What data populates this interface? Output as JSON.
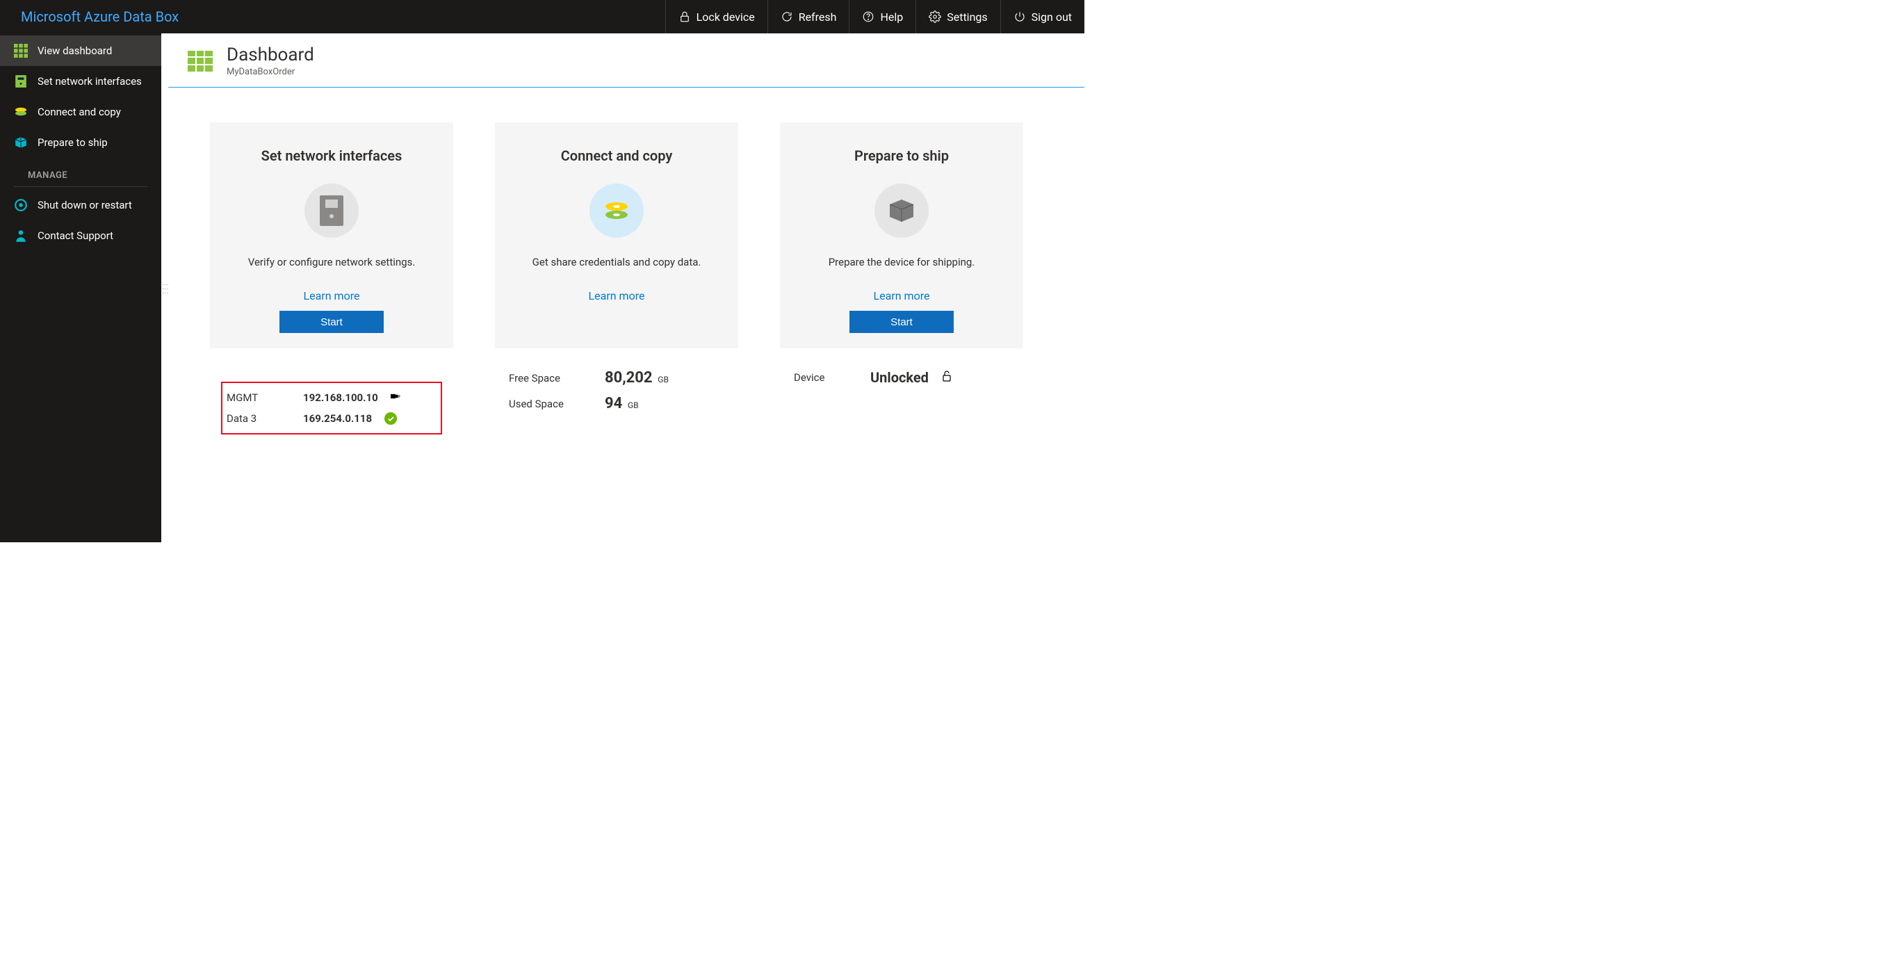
{
  "brand": "Microsoft Azure Data Box",
  "topbar": {
    "lock": "Lock device",
    "refresh": "Refresh",
    "help": "Help",
    "settings": "Settings",
    "signout": "Sign out"
  },
  "sidebar": {
    "items": [
      {
        "label": "View dashboard"
      },
      {
        "label": "Set network interfaces"
      },
      {
        "label": "Connect and copy"
      },
      {
        "label": "Prepare to ship"
      }
    ],
    "section": "MANAGE",
    "manage": [
      {
        "label": "Shut down or restart"
      },
      {
        "label": "Contact Support"
      }
    ]
  },
  "page": {
    "title": "Dashboard",
    "subtitle": "MyDataBoxOrder"
  },
  "cards": {
    "network": {
      "title": "Set network interfaces",
      "desc": "Verify or configure network settings.",
      "learn": "Learn more",
      "start": "Start",
      "rows": [
        {
          "name": "MGMT",
          "ip": "192.168.100.10"
        },
        {
          "name": "Data 3",
          "ip": "169.254.0.118"
        }
      ]
    },
    "copy": {
      "title": "Connect and copy",
      "desc": "Get share credentials and copy data.",
      "learn": "Learn more",
      "free_label": "Free Space",
      "free_value": "80,202",
      "free_unit": "GB",
      "used_label": "Used Space",
      "used_value": "94",
      "used_unit": "GB"
    },
    "ship": {
      "title": "Prepare to ship",
      "desc": "Prepare the device for shipping.",
      "learn": "Learn more",
      "start": "Start",
      "device_label": "Device",
      "device_status": "Unlocked"
    }
  }
}
